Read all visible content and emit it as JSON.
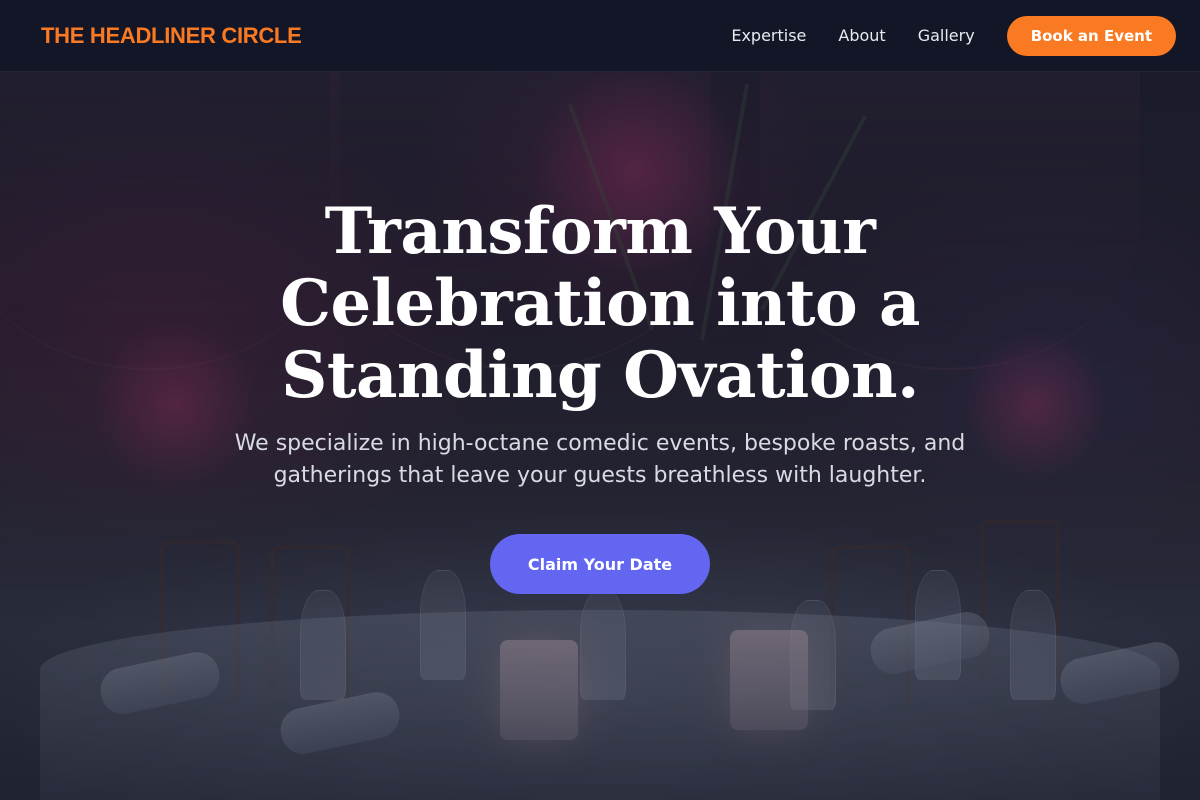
{
  "header": {
    "brand": "THE HEADLINER CIRCLE",
    "nav": [
      {
        "label": "Expertise"
      },
      {
        "label": "About"
      },
      {
        "label": "Gallery"
      }
    ],
    "cta_label": "Book an Event"
  },
  "hero": {
    "title": "Transform Your Celebration into a Standing Ovation.",
    "subtitle": "We specialize in high-octane comedic events, bespoke roasts, and gatherings that leave your guests breathless with laughter.",
    "cta_label": "Claim Your Date",
    "background_image": "dimly lit banquet table with glassware, candles and floral centerpiece"
  },
  "colors": {
    "brand_accent": "#f97a22",
    "cta_primary": "#6366f1",
    "header_bg": "#111626"
  }
}
